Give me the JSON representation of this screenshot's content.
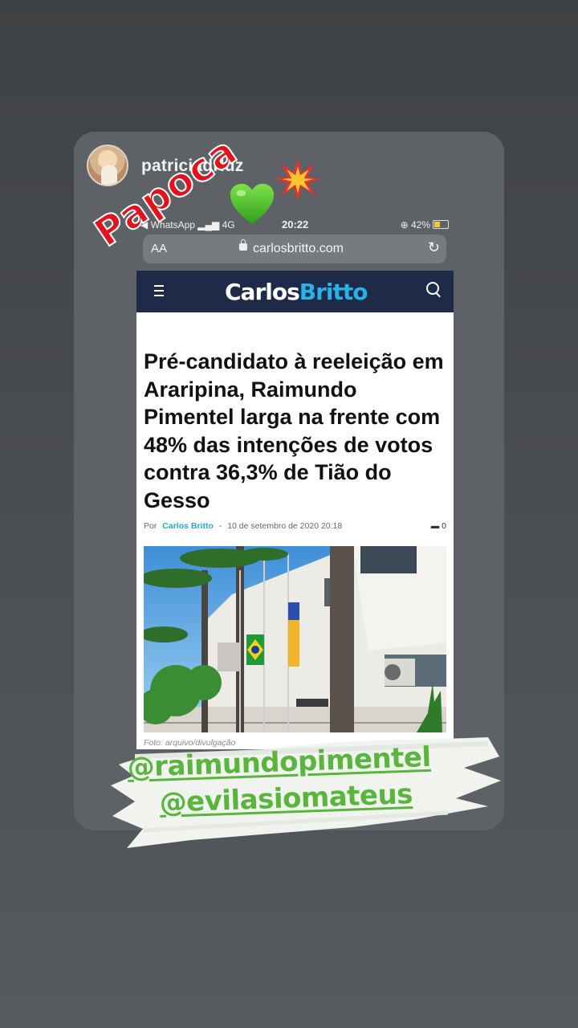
{
  "story": {
    "username": "patriciadrluz",
    "sticker_text": "Papoca",
    "mentions": [
      "@raimundopimentel",
      "@evilasiomateus"
    ]
  },
  "status_bar": {
    "back_app": "◀ WhatsApp",
    "signal": "4G",
    "time": "20:22",
    "battery": "42%"
  },
  "browser": {
    "text_size": "AA",
    "url": "carlosbritto.com",
    "reload_icon": "↻"
  },
  "site": {
    "logo_part1": "Carlos",
    "logo_part2": "Britto",
    "brand_colors": {
      "header": "#1d2a48",
      "accent": "#29b1e8"
    }
  },
  "article": {
    "headline": "Pré-candidato à reeleição em Araripina, Raimundo Pimentel larga na frente com 48% das intenções de votos contra 36,3% de Tião do Gesso",
    "by_label": "Por",
    "author": "Carlos Britto",
    "separator": "-",
    "date": "10 de setembro de 2020 20:18",
    "comment_count": "0",
    "photo_caption": "Foto: arquivo/divulgação"
  }
}
